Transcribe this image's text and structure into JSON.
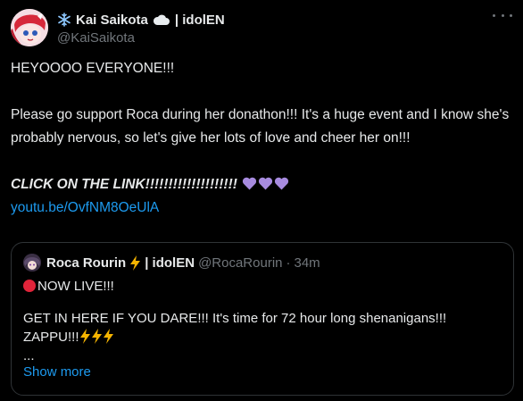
{
  "author": {
    "name": "Kai Saikota",
    "affiliation": "| idolEN",
    "handle": "@KaiSaikota"
  },
  "tweet": {
    "line1": "HEYOOOO EVERYONE!!!",
    "paragraph2": "Please go support Roca during her donathon!!! It's a huge event and I know she's probably nervous, so let's give her lots of love and cheer her on!!!",
    "cta": "CLICK ON THE LINK!!!!!!!!!!!!!!!!!!!!",
    "link": "youtu.be/OvfNM8OeUlA"
  },
  "quote": {
    "name": "Roca Rourin",
    "affiliation": "| idolEN",
    "handle": "@RocaRourin",
    "separator": "·",
    "time": "34m",
    "live_text": "NOW LIVE!!!",
    "body": "GET IN HERE IF YOU DARE!!! It's time for 72 hour long shenanigans!!! ZAPPU!!!",
    "ellipsis": "...",
    "show_more": "Show more"
  },
  "icons": [
    "snowflake-icon",
    "cloud-icon",
    "purple-heart-icon",
    "red-circle-icon",
    "lightning-icon",
    "more-icon"
  ],
  "colors": {
    "background": "#000000",
    "text": "#e7e9ea",
    "secondary": "#71767b",
    "link": "#1d9bf0",
    "border": "#2f3336",
    "heart": "#a78bdf",
    "live": "#e0243a",
    "bolt": "#f5b400"
  }
}
